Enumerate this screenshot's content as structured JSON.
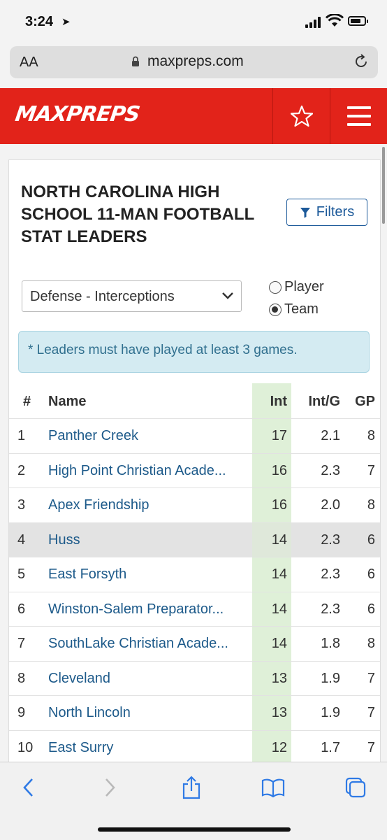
{
  "status_bar": {
    "time": "3:24"
  },
  "browser": {
    "text_size_label": "AA",
    "url": "maxpreps.com"
  },
  "site_header": {
    "logo_text": "MAXPREPS",
    "brand_color": "#e2231a"
  },
  "page": {
    "title": "NORTH CAROLINA HIGH SCHOOL 11-MAN FOOTBALL STAT LEADERS",
    "filters_label": "Filters",
    "stat_select": {
      "value": "Defense - Interceptions"
    },
    "view_options": [
      {
        "label": "Player",
        "checked": false
      },
      {
        "label": "Team",
        "checked": true
      }
    ],
    "note": "* Leaders must have played at least 3 games."
  },
  "table": {
    "columns": [
      "#",
      "Name",
      "Int",
      "Int/G",
      "GP"
    ],
    "rows": [
      {
        "rank": "1",
        "name": "Panther Creek",
        "int": "17",
        "int_g": "2.1",
        "gp": "8"
      },
      {
        "rank": "2",
        "name": "High Point Christian Acade...",
        "int": "16",
        "int_g": "2.3",
        "gp": "7"
      },
      {
        "rank": "3",
        "name": "Apex Friendship",
        "int": "16",
        "int_g": "2.0",
        "gp": "8"
      },
      {
        "rank": "4",
        "name": "Huss",
        "int": "14",
        "int_g": "2.3",
        "gp": "6"
      },
      {
        "rank": "5",
        "name": "East Forsyth",
        "int": "14",
        "int_g": "2.3",
        "gp": "6"
      },
      {
        "rank": "6",
        "name": "Winston-Salem Preparator...",
        "int": "14",
        "int_g": "2.3",
        "gp": "6"
      },
      {
        "rank": "7",
        "name": "SouthLake Christian Acade...",
        "int": "14",
        "int_g": "1.8",
        "gp": "8"
      },
      {
        "rank": "8",
        "name": "Cleveland",
        "int": "13",
        "int_g": "1.9",
        "gp": "7"
      },
      {
        "rank": "9",
        "name": "North Lincoln",
        "int": "13",
        "int_g": "1.9",
        "gp": "7"
      },
      {
        "rank": "10",
        "name": "East Surry",
        "int": "12",
        "int_g": "1.7",
        "gp": "7"
      }
    ]
  }
}
